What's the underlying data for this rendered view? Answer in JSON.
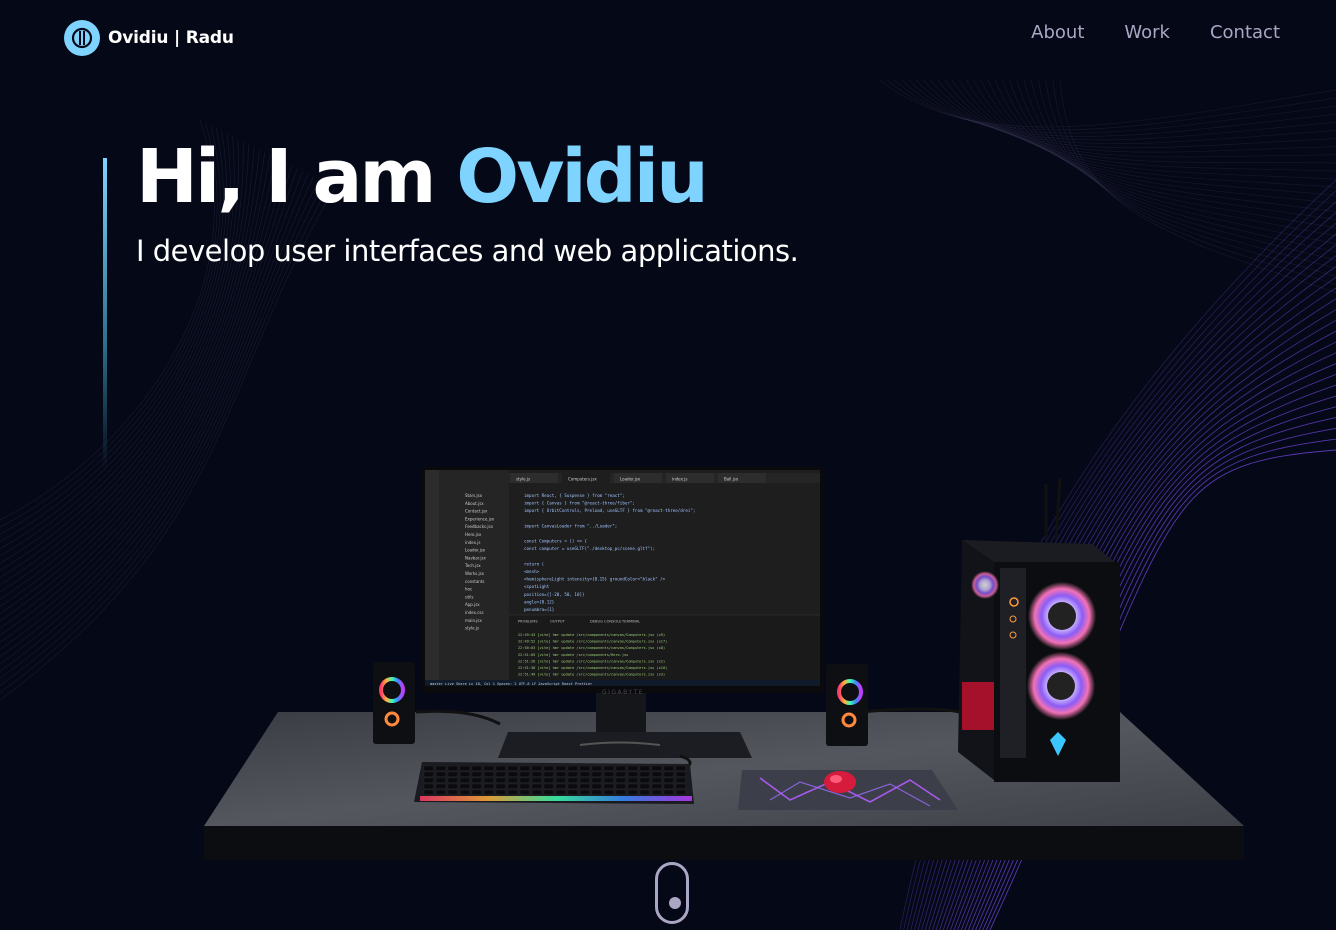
{
  "nav": {
    "logo_text": "Ovidiu | Radu",
    "links": [
      "About",
      "Work",
      "Contact"
    ]
  },
  "hero": {
    "greeting": "Hi, I am ",
    "name": "Ovidiu",
    "subtitle": "I develop user interfaces and web applications."
  },
  "monitor": {
    "brand": "GIGABYTE",
    "tabs": [
      "style.js",
      "Computers.jsx",
      "Loader.jsx",
      "index.js",
      "Ball.jsx"
    ],
    "explorer_files": [
      "Stars.jsx",
      "About.jsx",
      "Contact.jsx",
      "Experience.jsx",
      "Feedbacks.jsx",
      "Hero.jsx",
      "index.js",
      "Loader.jsx",
      "Navbar.jsx",
      "Tech.jsx",
      "Works.jsx",
      "constants",
      "hoc",
      "utils",
      "App.jsx",
      "index.css",
      "main.jsx",
      "style.js"
    ],
    "code_lines": [
      "import React, { Suspense } from \"react\";",
      "import { Canvas } from \"@react-three/fiber\";",
      "import { OrbitControls, Preload, useGLTF } from \"@react-three/drei\";",
      "",
      "import CanvasLoader from \"../Loader\";",
      "",
      "const Computers = () => {",
      "  const computer = useGLTF(\"./desktop_pc/scene.gltf\");",
      "",
      "  return (",
      "    <mesh>",
      "      <hemisphereLight intensity={0.15} groundColor=\"black\" />",
      "      <spotLight",
      "        position={[-20, 50, 10]}",
      "        angle={0.12}",
      "        penumbra={1}"
    ],
    "terminal_tabs": [
      "PROBLEMS",
      "OUTPUT",
      "DEBUG CONSOLE",
      "TERMINAL"
    ],
    "terminal_lines": [
      "22:49:43 [vite] hmr update /src/components/canvas/Computers.jsx (x9)",
      "22:49:52 [vite] hmr update /src/components/canvas/Computers.jsx (x17)",
      "22:50:03 [vite] hmr update /src/components/canvas/Computers.jsx (x8)",
      "22:51:05 [vite] hmr update /src/components/Hero.jsx",
      "22:51:26 [vite] hmr update /src/components/canvas/Computers.jsx (x2)",
      "22:51:38 [vite] hmr update /src/components/canvas/Computers.jsx (x10)",
      "22:51:49 [vite] hmr update /src/components/canvas/Computers.jsx (x3)"
    ],
    "status_bar": "master   Live Share   Ln 18, Col 1  Spaces: 2  UTF-8  LF  JavaScript React  Prettier"
  },
  "colors": {
    "background": "#050816",
    "accent": "#7fd4ff",
    "nav_text": "#aaa6c3",
    "wave": "#7a4ff0",
    "mousepad_glow": "#b45cff"
  },
  "icons": {
    "logo": "logo-mark-icon",
    "scroll": "mouse-scroll-icon"
  }
}
